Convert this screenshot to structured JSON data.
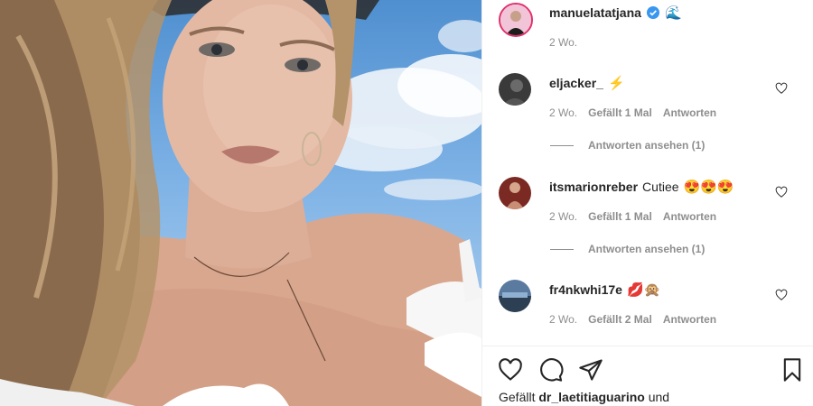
{
  "post": {
    "author": "manuelatatjana",
    "author_time": "2 Wo.",
    "verified_icon": "verified-badge-icon",
    "author_emoji": "🌊"
  },
  "comments": [
    {
      "user": "eljacker_",
      "text": "",
      "emojis": "⚡",
      "time": "2 Wo.",
      "likes": "Gefällt 1 Mal",
      "reply": "Antworten",
      "view_replies": "Antworten ansehen (1)"
    },
    {
      "user": "itsmarionreber",
      "text": "Cutiee",
      "emojis": "😍😍😍",
      "time": "2 Wo.",
      "likes": "Gefällt 1 Mal",
      "reply": "Antworten",
      "view_replies": "Antworten ansehen (1)"
    },
    {
      "user": "fr4nkwhi17e",
      "text": "",
      "emojis": "💋🙊",
      "time": "2 Wo.",
      "likes": "Gefällt 2 Mal",
      "reply": "Antworten"
    }
  ],
  "footer": {
    "liked_by_prefix": "Gefällt",
    "liked_by_user": "dr_laetitiaguarino",
    "liked_by_suffix": "und"
  },
  "colors": {
    "text": "#262626",
    "muted": "#8e8e8e",
    "verified": "#3897f0",
    "border": "#efefef"
  }
}
